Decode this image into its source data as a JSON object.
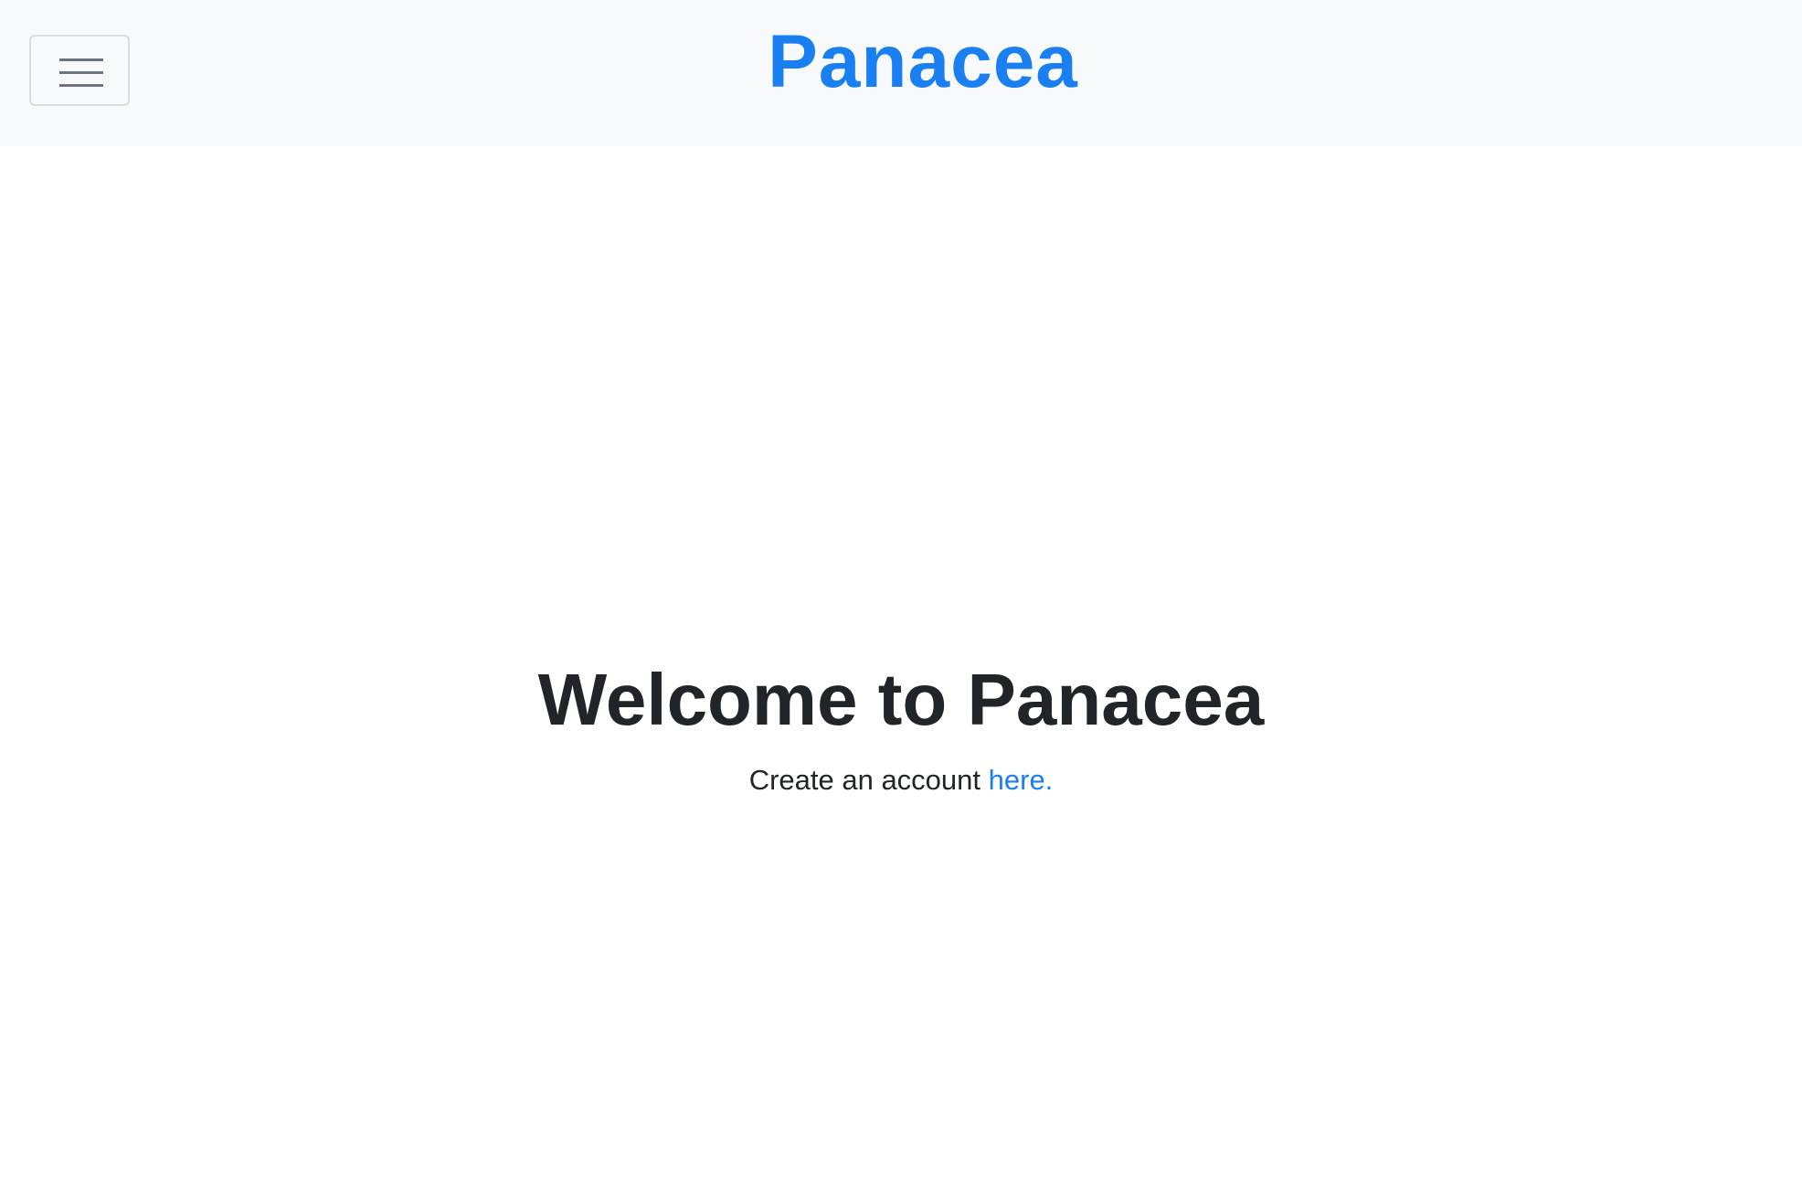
{
  "navbar": {
    "brand": "Panacea",
    "toggle_icon": "hamburger-menu-icon"
  },
  "hero": {
    "title": "Welcome to Panacea",
    "subtitle_prefix": "Create an account ",
    "link_text": "here."
  },
  "colors": {
    "brand": "#1a7ff0",
    "navbar_bg": "#f8f9fa",
    "text": "#212529",
    "icon": "#6c757d"
  }
}
